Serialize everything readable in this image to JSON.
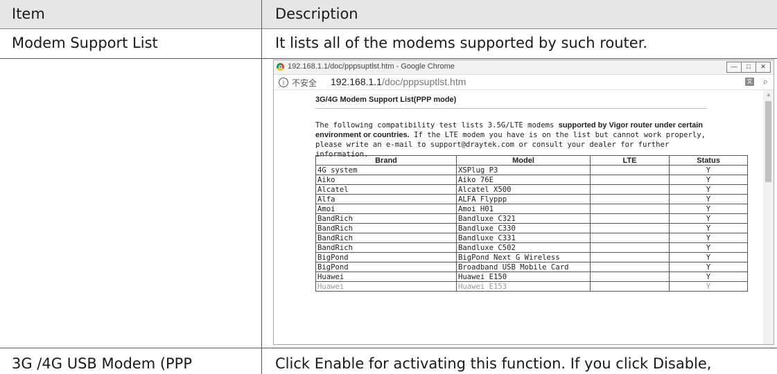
{
  "header": {
    "item": "Item",
    "description": "Description"
  },
  "rows": [
    {
      "item": "Modem Support List",
      "description": "It lists all of the modems supported by such router."
    },
    {
      "item": "3G /4G USB Modem (PPP",
      "description": "Click Enable for activating this function. If you click Disable,"
    }
  ],
  "browser": {
    "window_title": "192.168.1.1/doc/pppsuptlst.htm - Google Chrome",
    "insecure_label": "不安全",
    "url_host": "192.168.1.1",
    "url_path": "/doc/pppsuptlst.htm",
    "page_title": "3G/4G Modem Support List(PPP mode)",
    "intro_part1": "The following compatibility test lists 3.5G/LTE modems ",
    "intro_bold1": "supported by Vigor router under certain environment or countries.",
    "intro_part2": " If the LTE modem you have is on the list but cannot work properly, please write an e-mail to support@draytek.com or consult your dealer for further information.",
    "table_headers": {
      "brand": "Brand",
      "model": "Model",
      "lte": "LTE",
      "status": "Status"
    },
    "table_rows": [
      {
        "brand": "4G system",
        "model": "XSPlug P3",
        "lte": "",
        "status": "Y"
      },
      {
        "brand": "Aiko",
        "model": "Aiko 76E",
        "lte": "",
        "status": "Y"
      },
      {
        "brand": "Alcatel",
        "model": "Alcatel X500",
        "lte": "",
        "status": "Y"
      },
      {
        "brand": "Alfa",
        "model": "ALFA Flyppp",
        "lte": "",
        "status": "Y"
      },
      {
        "brand": "Amoi",
        "model": "Amoi H01",
        "lte": "",
        "status": "Y"
      },
      {
        "brand": "BandRich",
        "model": "Bandluxe C321",
        "lte": "",
        "status": "Y"
      },
      {
        "brand": "BandRich",
        "model": "Bandluxe C330",
        "lte": "",
        "status": "Y"
      },
      {
        "brand": "BandRich",
        "model": "Bandluxe C331",
        "lte": "",
        "status": "Y"
      },
      {
        "brand": "BandRich",
        "model": "Bandluxe C502",
        "lte": "",
        "status": "Y"
      },
      {
        "brand": "BigPond",
        "model": "BigPond Next G Wireless",
        "lte": "",
        "status": "Y"
      },
      {
        "brand": "BigPond",
        "model": "Broadband USB Mobile Card",
        "lte": "",
        "status": "Y"
      },
      {
        "brand": "Huawei",
        "model": "Huawei E150",
        "lte": "",
        "status": "Y"
      },
      {
        "brand": "Huawei",
        "model": "Huawei E153",
        "lte": "",
        "status": "Y"
      }
    ]
  }
}
